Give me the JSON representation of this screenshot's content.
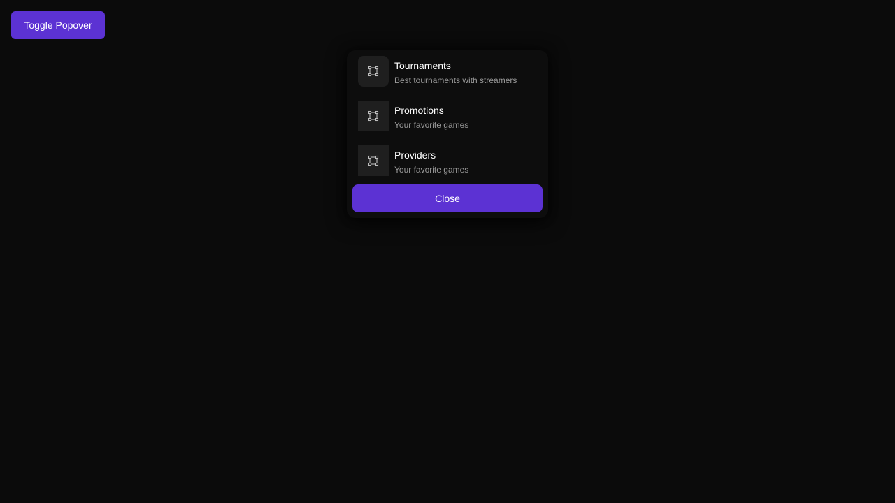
{
  "toolbar": {
    "toggle_label": "Toggle Popover"
  },
  "popover": {
    "items": [
      {
        "title": "Tournaments",
        "subtitle": "Best tournaments with streamers",
        "icon": "frame-square-icon"
      },
      {
        "title": "Promotions",
        "subtitle": "Your favorite games",
        "icon": "frame-square-icon"
      },
      {
        "title": "Providers",
        "subtitle": "Your favorite games",
        "icon": "frame-square-icon"
      }
    ],
    "close_label": "Close"
  },
  "colors": {
    "background": "#0b0b0b",
    "accent": "#5c32d3",
    "popover_bg": "#0d0d0d",
    "icon_tile": "#1f1f1f",
    "muted_text": "#9a9a9a"
  }
}
